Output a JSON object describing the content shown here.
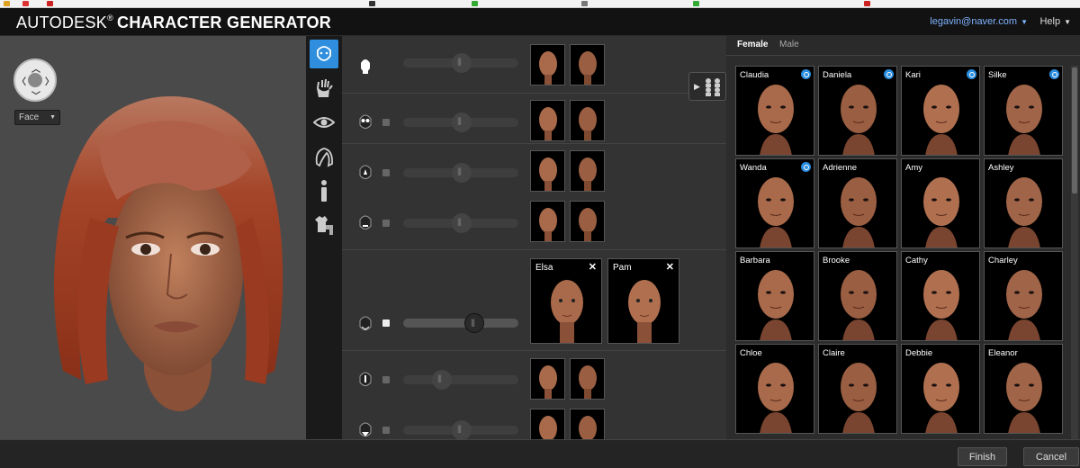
{
  "header": {
    "brand_light": "AUTODESK",
    "brand_reg": "®",
    "brand_bold": "CHARACTER GENERATOR",
    "user_email": "legavin@naver.com",
    "help_label": "Help"
  },
  "preview": {
    "view_select": "Face"
  },
  "mixer": {
    "blend_pair": [
      {
        "name": "Elsa",
        "close": "✕"
      },
      {
        "name": "Pam",
        "close": "✕"
      }
    ],
    "blend_level_fraction": 0.64
  },
  "library": {
    "tabs": [
      "Female",
      "Male"
    ],
    "characters": [
      "Claudia",
      "Daniela",
      "Kari",
      "Silke",
      "Wanda",
      "Adrienne",
      "Amy",
      "Ashley",
      "Barbara",
      "Brooke",
      "Cathy",
      "Charley",
      "Chloe",
      "Claire",
      "Debbie",
      "Eleanor"
    ]
  },
  "footer": {
    "finish_label": "Finish",
    "cancel_label": "Cancel"
  },
  "icons": {
    "preview_nav": "camera-orbit-icon",
    "strip": [
      "face-icon",
      "hand-icon",
      "eye-icon",
      "hair-icon",
      "body-icon",
      "clothes-icon"
    ]
  },
  "colors": {
    "accent": "#2f8fde",
    "link": "#7fb2ff",
    "hair": "#a0432a",
    "skin": "#a86a4a"
  }
}
